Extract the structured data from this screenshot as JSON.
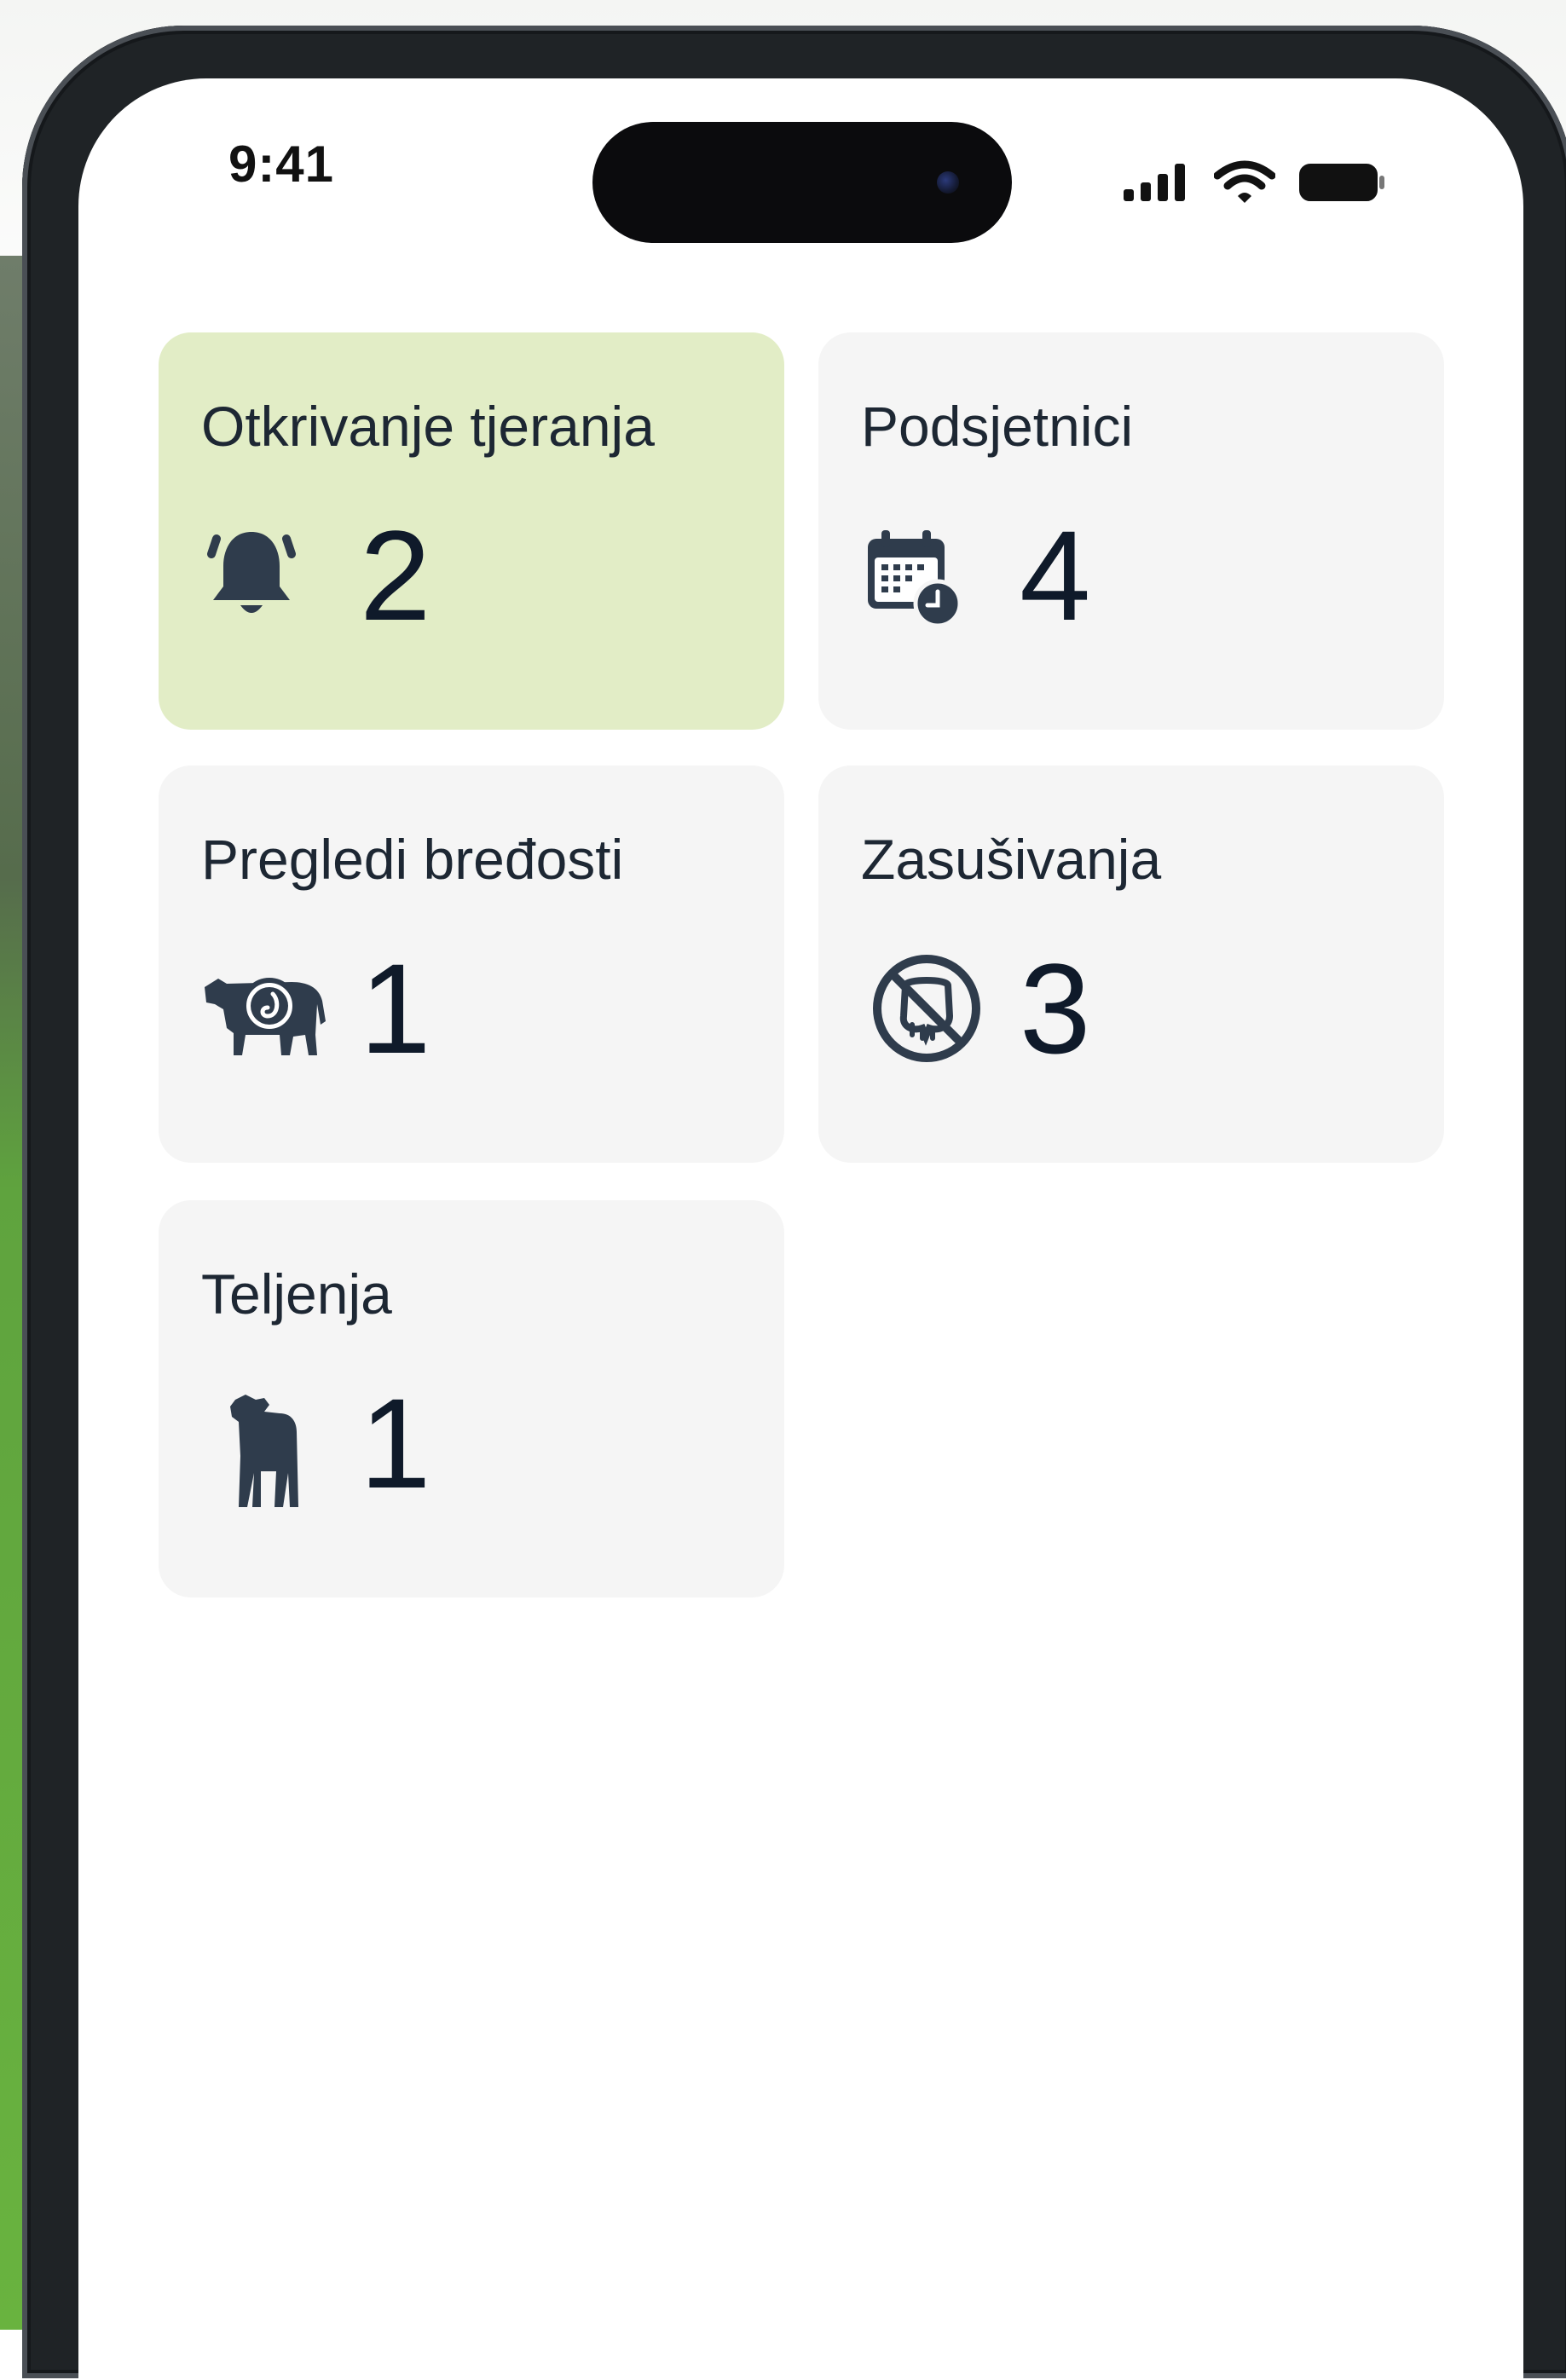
{
  "status_bar": {
    "time": "9:41",
    "icons": [
      "signal-bars-icon",
      "wifi-icon",
      "battery-icon"
    ]
  },
  "dashboard": {
    "cards": [
      {
        "title": "Otkrivanje tjeranja",
        "count": "2",
        "icon": "bell-alarm-icon",
        "highlighted": true,
        "background": "#e2edc6"
      },
      {
        "title": "Podsjetnici",
        "count": "4",
        "icon": "calendar-clock-icon",
        "highlighted": false,
        "background": "#f5f5f5"
      },
      {
        "title": "Pregledi bređosti",
        "count": "1",
        "icon": "cow-pregnancy-icon",
        "highlighted": false,
        "background": "#f5f5f5"
      },
      {
        "title": "Zasušivanja",
        "count": "3",
        "icon": "no-milk-udder-icon",
        "highlighted": false,
        "background": "#f5f5f5"
      },
      {
        "title": "Teljenja",
        "count": "1",
        "icon": "calf-icon",
        "highlighted": false,
        "background": "#f5f5f5"
      }
    ]
  },
  "colors": {
    "icon": "#2f3c4c",
    "text": "#1d2733",
    "highlight": "#e2edc6",
    "card": "#f5f5f5"
  }
}
